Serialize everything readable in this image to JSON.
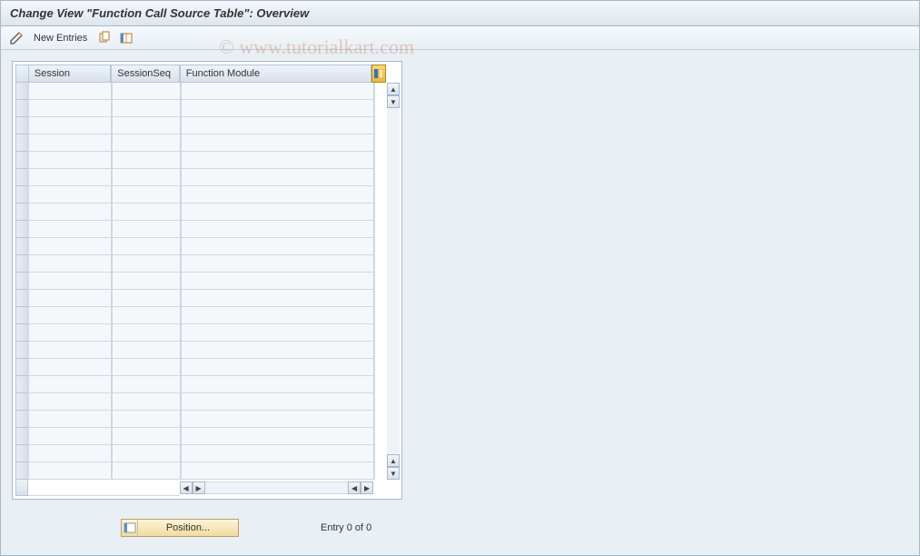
{
  "title": "Change View \"Function Call Source Table\": Overview",
  "toolbar": {
    "new_entries_label": "New Entries"
  },
  "table": {
    "columns": {
      "session": "Session",
      "session_seq": "SessionSeq",
      "function_module": "Function Module"
    },
    "row_count": 23
  },
  "footer": {
    "position_label": "Position...",
    "entry_text": "Entry 0 of 0"
  },
  "watermark": "© www.tutorialkart.com"
}
